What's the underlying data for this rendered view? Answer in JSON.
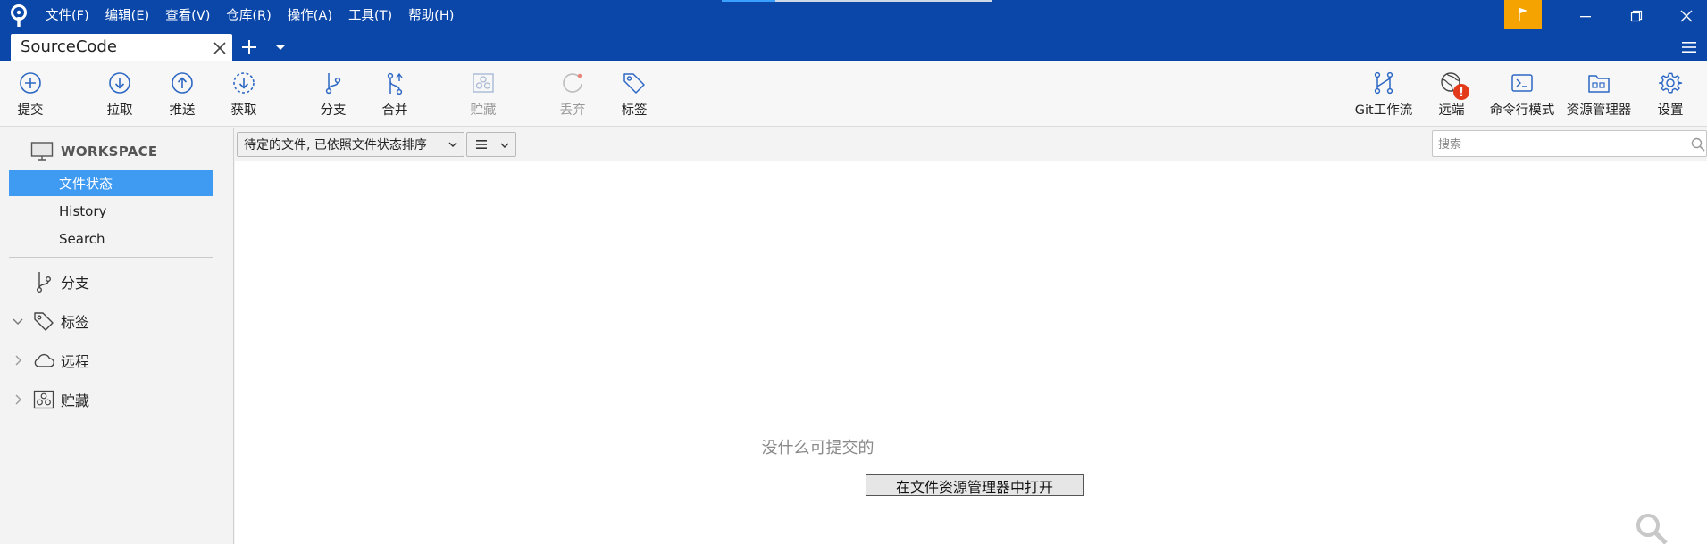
{
  "menu": [
    "文件(F)",
    "编辑(E)",
    "查看(V)",
    "仓库(R)",
    "操作(A)",
    "工具(T)",
    "帮助(H)"
  ],
  "tab": {
    "title": "SourceCode"
  },
  "toolbar": {
    "commit": "提交",
    "pull": "拉取",
    "push": "推送",
    "fetch": "获取",
    "branch": "分支",
    "merge": "合并",
    "stash": "贮藏",
    "discard": "丢弃",
    "tag": "标签",
    "gitflow": "Git工作流",
    "remote": "远端",
    "terminal": "命令行模式",
    "explorer": "资源管理器",
    "settings": "设置"
  },
  "sidebar": {
    "workspace": "WORKSPACE",
    "items": [
      "文件状态",
      "History",
      "Search"
    ],
    "groups": [
      "分支",
      "标签",
      "远程",
      "贮藏"
    ]
  },
  "filter": {
    "sort_label": "待定的文件, 已依照文件状态排序",
    "view_glyph": "≡"
  },
  "search": {
    "placeholder": "搜索"
  },
  "empty": {
    "message": "没什么可提交的",
    "open_button": "在文件资源管理器中打开"
  },
  "colors": {
    "title_bar": "#0a47a9",
    "selected_item": "#3f9bf2",
    "flag_button": "#f5a300",
    "toolbar_icon": "#2d68c4",
    "remote_badge": "#e23a1a"
  },
  "icons": {
    "app": "sourcetree-logo-icon",
    "flag": "flag-icon",
    "remote_badge_text": "!"
  }
}
